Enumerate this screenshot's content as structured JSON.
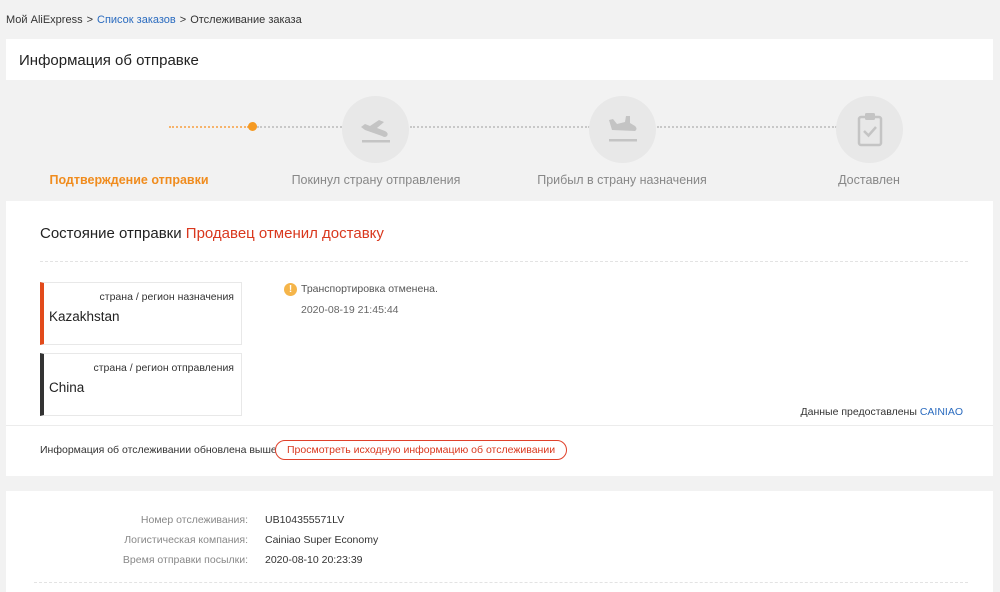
{
  "breadcrumb": {
    "home": "Мой AliExpress",
    "sep1": ">",
    "orders": "Список заказов",
    "sep2": ">",
    "current": "Отслеживание заказа"
  },
  "shipping": {
    "title": "Информация об отправке",
    "steps": [
      {
        "label": "Подтверждение отправки",
        "icon": "current-dot",
        "state": "current"
      },
      {
        "label": "Покинул страну отправления",
        "icon": "airplane-takeoff-icon",
        "state": "pending"
      },
      {
        "label": "Прибыл в страну назначения",
        "icon": "airplane-landing-icon",
        "state": "pending"
      },
      {
        "label": "Доставлен",
        "icon": "clipboard-check-icon",
        "state": "pending"
      }
    ],
    "status_label": "Состояние отправки",
    "status_value": "Продавец отменил доставку",
    "destination_caption": "страна / регион назначения",
    "destination_value": "Kazakhstan",
    "origin_caption": "страна / регион отправления",
    "origin_value": "China",
    "event_text": "Транспортировка отменена.",
    "event_time": "2020-08-19 21:45:44",
    "provider_label": "Данные предоставлены",
    "provider_name": "CAINIAO",
    "updated_text": "Информация об отслеживании обновлена выше",
    "original_button": "Просмотреть исходную информацию об отслеживании"
  },
  "details": {
    "rows": [
      {
        "label": "Номер отслеживания:",
        "value": "UB104355571LV"
      },
      {
        "label": "Логистическая компания:",
        "value": "Cainiao Super Economy"
      },
      {
        "label": "Время отправки посылки:",
        "value": "2020-08-10 20:23:39"
      }
    ]
  },
  "colors": {
    "accent_orange": "#f08c1e",
    "status_red": "#d9381e",
    "link_blue": "#2a6bbf"
  }
}
